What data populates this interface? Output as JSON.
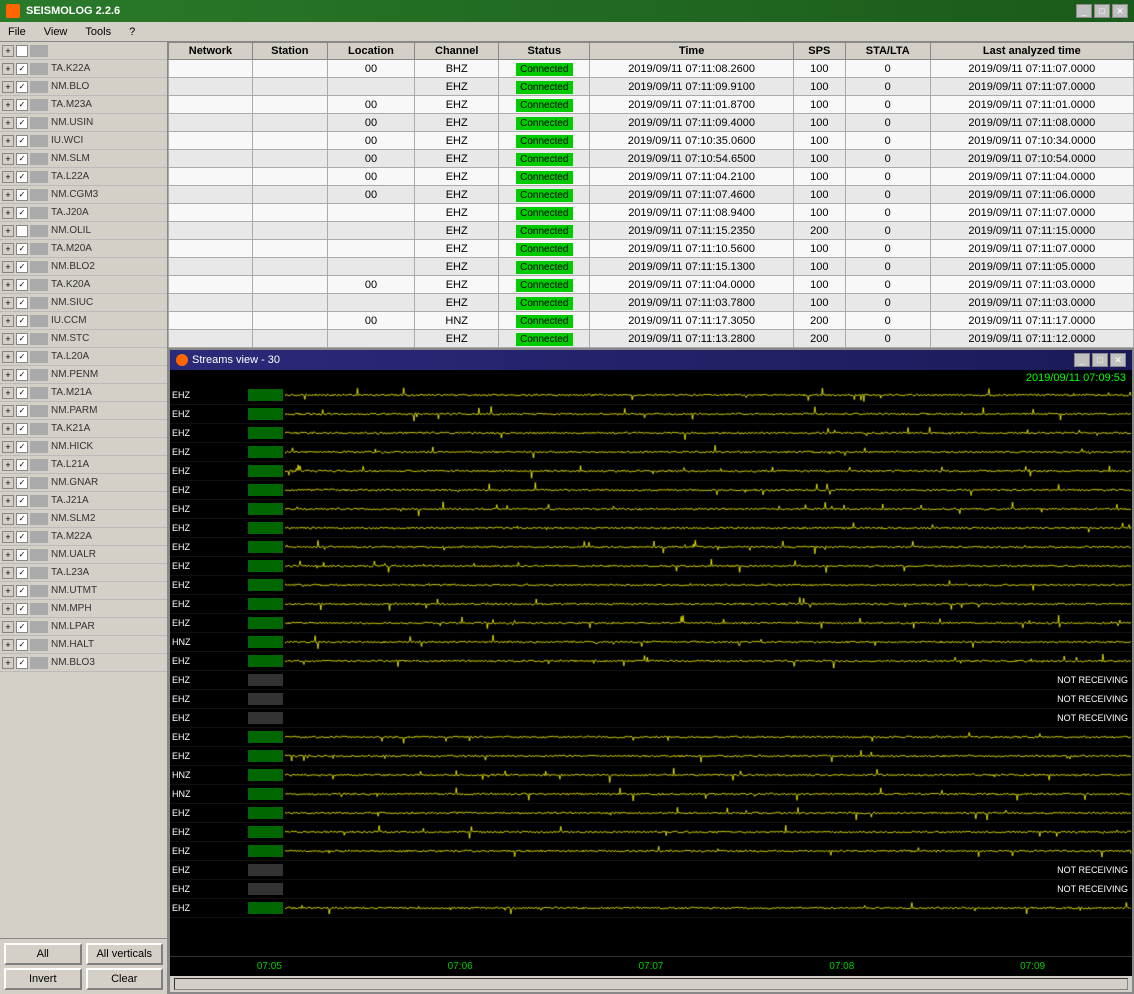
{
  "app": {
    "title": "SEISMOLOG 2.2.6",
    "menu": [
      "File",
      "View",
      "Tools",
      "?"
    ]
  },
  "toolbar": {
    "all_label": "All",
    "all_verticals_label": "All verticals",
    "invert_label": "Invert",
    "clear_label": "Clear"
  },
  "table": {
    "headers": [
      "Network",
      "Station",
      "Location",
      "Channel",
      "Status",
      "Time",
      "SPS",
      "STA/LTA",
      "Last analyzed time"
    ],
    "rows": [
      [
        "",
        "",
        "00",
        "BHZ",
        "Connected",
        "2019/09/11 07:11:08.2600",
        "100",
        "0",
        "2019/09/11 07:11:07.0000"
      ],
      [
        "",
        "",
        "",
        "EHZ",
        "Connected",
        "2019/09/11 07:11:09.9100",
        "100",
        "0",
        "2019/09/11 07:11:07.0000"
      ],
      [
        "",
        "",
        "00",
        "EHZ",
        "Connected",
        "2019/09/11 07:11:01.8700",
        "100",
        "0",
        "2019/09/11 07:11:01.0000"
      ],
      [
        "",
        "",
        "00",
        "EHZ",
        "Connected",
        "2019/09/11 07:11:09.4000",
        "100",
        "0",
        "2019/09/11 07:11:08.0000"
      ],
      [
        "",
        "",
        "00",
        "EHZ",
        "Connected",
        "2019/09/11 07:10:35.0600",
        "100",
        "0",
        "2019/09/11 07:10:34.0000"
      ],
      [
        "",
        "",
        "00",
        "EHZ",
        "Connected",
        "2019/09/11 07:10:54.6500",
        "100",
        "0",
        "2019/09/11 07:10:54.0000"
      ],
      [
        "",
        "",
        "00",
        "EHZ",
        "Connected",
        "2019/09/11 07:11:04.2100",
        "100",
        "0",
        "2019/09/11 07:11:04.0000"
      ],
      [
        "",
        "",
        "00",
        "EHZ",
        "Connected",
        "2019/09/11 07:11:07.4600",
        "100",
        "0",
        "2019/09/11 07:11:06.0000"
      ],
      [
        "",
        "",
        "",
        "EHZ",
        "Connected",
        "2019/09/11 07:11:08.9400",
        "100",
        "0",
        "2019/09/11 07:11:07.0000"
      ],
      [
        "",
        "",
        "",
        "EHZ",
        "Connected",
        "2019/09/11 07:11:15.2350",
        "200",
        "0",
        "2019/09/11 07:11:15.0000"
      ],
      [
        "",
        "",
        "",
        "EHZ",
        "Connected",
        "2019/09/11 07:11:10.5600",
        "100",
        "0",
        "2019/09/11 07:11:07.0000"
      ],
      [
        "",
        "",
        "",
        "EHZ",
        "Connected",
        "2019/09/11 07:11:15.1300",
        "100",
        "0",
        "2019/09/11 07:11:05.0000"
      ],
      [
        "",
        "",
        "00",
        "EHZ",
        "Connected",
        "2019/09/11 07:11:04.0000",
        "100",
        "0",
        "2019/09/11 07:11:03.0000"
      ],
      [
        "",
        "",
        "",
        "EHZ",
        "Connected",
        "2019/09/11 07:11:03.7800",
        "100",
        "0",
        "2019/09/11 07:11:03.0000"
      ],
      [
        "",
        "",
        "00",
        "HNZ",
        "Connected",
        "2019/09/11 07:11:17.3050",
        "200",
        "0",
        "2019/09/11 07:11:17.0000"
      ],
      [
        "",
        "",
        "",
        "EHZ",
        "Connected",
        "2019/09/11 07:11:13.2800",
        "200",
        "0",
        "2019/09/11 07:11:12.0000"
      ]
    ]
  },
  "streams": {
    "title": "Streams view - 30",
    "timestamp": "2019/09/11 07:09:53",
    "timeline": [
      "07:05",
      "07:06",
      "07:07",
      "07:08",
      "07:09"
    ],
    "rows": [
      {
        "channel": "EHZ",
        "station": "",
        "has_signal": true,
        "not_receiving": false
      },
      {
        "channel": "EHZ",
        "station": "",
        "has_signal": true,
        "not_receiving": false
      },
      {
        "channel": "EHZ",
        "station": "",
        "has_signal": true,
        "not_receiving": false
      },
      {
        "channel": "EHZ",
        "station": "",
        "has_signal": true,
        "not_receiving": false
      },
      {
        "channel": "EHZ",
        "station": "",
        "has_signal": true,
        "not_receiving": false
      },
      {
        "channel": "EHZ",
        "station": "",
        "has_signal": true,
        "not_receiving": false
      },
      {
        "channel": "EHZ",
        "station": "",
        "has_signal": true,
        "not_receiving": false
      },
      {
        "channel": "EHZ",
        "station": "",
        "has_signal": true,
        "not_receiving": false
      },
      {
        "channel": "EHZ",
        "station": "",
        "has_signal": true,
        "not_receiving": false
      },
      {
        "channel": "EHZ",
        "station": "",
        "has_signal": true,
        "not_receiving": false
      },
      {
        "channel": "EHZ",
        "station": "",
        "has_signal": true,
        "not_receiving": false
      },
      {
        "channel": "EHZ",
        "station": "",
        "has_signal": true,
        "not_receiving": false
      },
      {
        "channel": "EHZ",
        "station": "",
        "has_signal": true,
        "not_receiving": false
      },
      {
        "channel": "HNZ",
        "station": "",
        "has_signal": true,
        "not_receiving": false
      },
      {
        "channel": "EHZ",
        "station": "",
        "has_signal": true,
        "not_receiving": false
      },
      {
        "channel": "EHZ",
        "station": "",
        "has_signal": false,
        "not_receiving": true
      },
      {
        "channel": "EHZ",
        "station": "",
        "has_signal": false,
        "not_receiving": true
      },
      {
        "channel": "EHZ",
        "station": "",
        "has_signal": false,
        "not_receiving": true
      },
      {
        "channel": "EHZ",
        "station": "",
        "has_signal": true,
        "not_receiving": false
      },
      {
        "channel": "EHZ",
        "station": "",
        "has_signal": true,
        "not_receiving": false
      },
      {
        "channel": "HNZ",
        "station": "",
        "has_signal": true,
        "not_receiving": false
      },
      {
        "channel": "HNZ",
        "station": "",
        "has_signal": true,
        "not_receiving": false
      },
      {
        "channel": "EHZ",
        "station": "",
        "has_signal": true,
        "not_receiving": false
      },
      {
        "channel": "EHZ",
        "station": "",
        "has_signal": true,
        "not_receiving": false
      },
      {
        "channel": "EHZ",
        "station": "",
        "has_signal": true,
        "not_receiving": false
      },
      {
        "channel": "EHZ",
        "station": "",
        "has_signal": false,
        "not_receiving": true
      },
      {
        "channel": "EHZ",
        "station": "",
        "has_signal": false,
        "not_receiving": true
      },
      {
        "channel": "EHZ",
        "station": "",
        "has_signal": true,
        "not_receiving": false
      }
    ]
  },
  "sidebar_rows": [
    {
      "expand": "+",
      "checked": false,
      "label": ""
    },
    {
      "expand": "+",
      "checked": true,
      "label": ""
    },
    {
      "expand": "+",
      "checked": true,
      "label": ""
    },
    {
      "expand": "+",
      "checked": true,
      "label": ""
    },
    {
      "expand": "+",
      "checked": true,
      "label": ""
    },
    {
      "expand": "+",
      "checked": true,
      "label": ""
    },
    {
      "expand": "+",
      "checked": true,
      "label": ""
    },
    {
      "expand": "+",
      "checked": true,
      "label": ""
    },
    {
      "expand": "+",
      "checked": true,
      "label": ""
    },
    {
      "expand": "+",
      "checked": true,
      "label": ""
    },
    {
      "expand": "+",
      "checked": false,
      "label": ""
    },
    {
      "expand": "+",
      "checked": true,
      "label": ""
    },
    {
      "expand": "+",
      "checked": true,
      "label": ""
    },
    {
      "expand": "+",
      "checked": true,
      "label": ""
    },
    {
      "expand": "+",
      "checked": true,
      "label": ""
    },
    {
      "expand": "+",
      "checked": true,
      "label": ""
    },
    {
      "expand": "+",
      "checked": true,
      "label": ""
    },
    {
      "expand": "+",
      "checked": true,
      "label": ""
    },
    {
      "expand": "+",
      "checked": true,
      "label": ""
    },
    {
      "expand": "+",
      "checked": true,
      "label": ""
    },
    {
      "expand": "+",
      "checked": true,
      "label": ""
    },
    {
      "expand": "+",
      "checked": true,
      "label": ""
    },
    {
      "expand": "+",
      "checked": true,
      "label": ""
    },
    {
      "expand": "+",
      "checked": true,
      "label": ""
    },
    {
      "expand": "+",
      "checked": true,
      "label": ""
    },
    {
      "expand": "+",
      "checked": true,
      "label": ""
    },
    {
      "expand": "+",
      "checked": true,
      "label": ""
    },
    {
      "expand": "+",
      "checked": true,
      "label": ""
    },
    {
      "expand": "+",
      "checked": true,
      "label": ""
    },
    {
      "expand": "+",
      "checked": true,
      "label": ""
    },
    {
      "expand": "+",
      "checked": true,
      "label": ""
    },
    {
      "expand": "+",
      "checked": true,
      "label": ""
    },
    {
      "expand": "+",
      "checked": true,
      "label": ""
    },
    {
      "expand": "+",
      "checked": true,
      "label": ""
    },
    {
      "expand": "+",
      "checked": true,
      "label": ""
    }
  ],
  "not_receiving_label": "NOT RECEIVING"
}
